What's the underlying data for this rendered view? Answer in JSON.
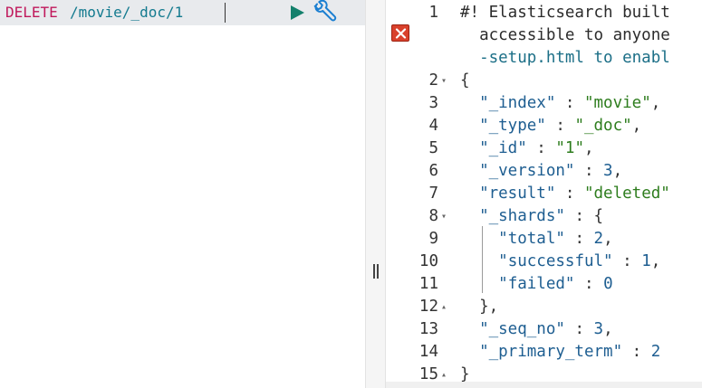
{
  "request": {
    "method": "DELETE",
    "path": "/movie/_doc/1"
  },
  "icons": {
    "run": "play-triangle-icon",
    "settings": "wrench-icon",
    "error": "close-x-icon"
  },
  "colors": {
    "method": "#c0185b",
    "path": "#137a8f",
    "run": "#13806c",
    "wrench": "#1b7fd1",
    "error": "#d9412c"
  },
  "response": {
    "lines": [
      {
        "n": "1",
        "fold": "",
        "parts": [
          {
            "t": "#! Elasticsearch built",
            "c": "comment"
          }
        ]
      },
      {
        "n": "",
        "fold": "",
        "parts": [
          {
            "t": "  accessible to anyone",
            "c": "comment"
          }
        ]
      },
      {
        "n": "",
        "fold": "",
        "parts": [
          {
            "t": "  -setup.html to enabl",
            "c": "link-comment"
          }
        ]
      },
      {
        "n": "2",
        "fold": "▾",
        "parts": [
          {
            "t": "{",
            "c": ""
          }
        ]
      },
      {
        "n": "3",
        "fold": "",
        "parts": [
          {
            "t": "  ",
            "c": ""
          },
          {
            "t": "\"_index\"",
            "c": "key"
          },
          {
            "t": " : ",
            "c": ""
          },
          {
            "t": "\"movie\"",
            "c": "str"
          },
          {
            "t": ",",
            "c": ""
          }
        ]
      },
      {
        "n": "4",
        "fold": "",
        "parts": [
          {
            "t": "  ",
            "c": ""
          },
          {
            "t": "\"_type\"",
            "c": "key"
          },
          {
            "t": " : ",
            "c": ""
          },
          {
            "t": "\"_doc\"",
            "c": "str"
          },
          {
            "t": ",",
            "c": ""
          }
        ]
      },
      {
        "n": "5",
        "fold": "",
        "parts": [
          {
            "t": "  ",
            "c": ""
          },
          {
            "t": "\"_id\"",
            "c": "key"
          },
          {
            "t": " : ",
            "c": ""
          },
          {
            "t": "\"1\"",
            "c": "str"
          },
          {
            "t": ",",
            "c": ""
          }
        ]
      },
      {
        "n": "6",
        "fold": "",
        "parts": [
          {
            "t": "  ",
            "c": ""
          },
          {
            "t": "\"_version\"",
            "c": "key"
          },
          {
            "t": " : ",
            "c": ""
          },
          {
            "t": "3",
            "c": "num"
          },
          {
            "t": ",",
            "c": ""
          }
        ]
      },
      {
        "n": "7",
        "fold": "",
        "parts": [
          {
            "t": "  ",
            "c": ""
          },
          {
            "t": "\"result\"",
            "c": "key"
          },
          {
            "t": " : ",
            "c": ""
          },
          {
            "t": "\"deleted\"",
            "c": "str"
          }
        ]
      },
      {
        "n": "8",
        "fold": "▾",
        "parts": [
          {
            "t": "  ",
            "c": ""
          },
          {
            "t": "\"_shards\"",
            "c": "key"
          },
          {
            "t": " : {",
            "c": ""
          }
        ]
      },
      {
        "n": "9",
        "fold": "",
        "parts": [
          {
            "t": "    ",
            "c": ""
          },
          {
            "t": "\"total\"",
            "c": "key"
          },
          {
            "t": " : ",
            "c": ""
          },
          {
            "t": "2",
            "c": "num"
          },
          {
            "t": ",",
            "c": ""
          }
        ]
      },
      {
        "n": "10",
        "fold": "",
        "parts": [
          {
            "t": "    ",
            "c": ""
          },
          {
            "t": "\"successful\"",
            "c": "key"
          },
          {
            "t": " : ",
            "c": ""
          },
          {
            "t": "1",
            "c": "num"
          },
          {
            "t": ",",
            "c": ""
          }
        ]
      },
      {
        "n": "11",
        "fold": "",
        "parts": [
          {
            "t": "    ",
            "c": ""
          },
          {
            "t": "\"failed\"",
            "c": "key"
          },
          {
            "t": " : ",
            "c": ""
          },
          {
            "t": "0",
            "c": "num"
          }
        ]
      },
      {
        "n": "12",
        "fold": "▴",
        "parts": [
          {
            "t": "  },",
            "c": ""
          }
        ]
      },
      {
        "n": "13",
        "fold": "",
        "parts": [
          {
            "t": "  ",
            "c": ""
          },
          {
            "t": "\"_seq_no\"",
            "c": "key"
          },
          {
            "t": " : ",
            "c": ""
          },
          {
            "t": "3",
            "c": "num"
          },
          {
            "t": ",",
            "c": ""
          }
        ]
      },
      {
        "n": "14",
        "fold": "",
        "parts": [
          {
            "t": "  ",
            "c": ""
          },
          {
            "t": "\"_primary_term\"",
            "c": "key"
          },
          {
            "t": " : ",
            "c": ""
          },
          {
            "t": "2",
            "c": "num"
          }
        ]
      },
      {
        "n": "15",
        "fold": "▴",
        "parts": [
          {
            "t": "}",
            "c": ""
          }
        ]
      }
    ]
  }
}
